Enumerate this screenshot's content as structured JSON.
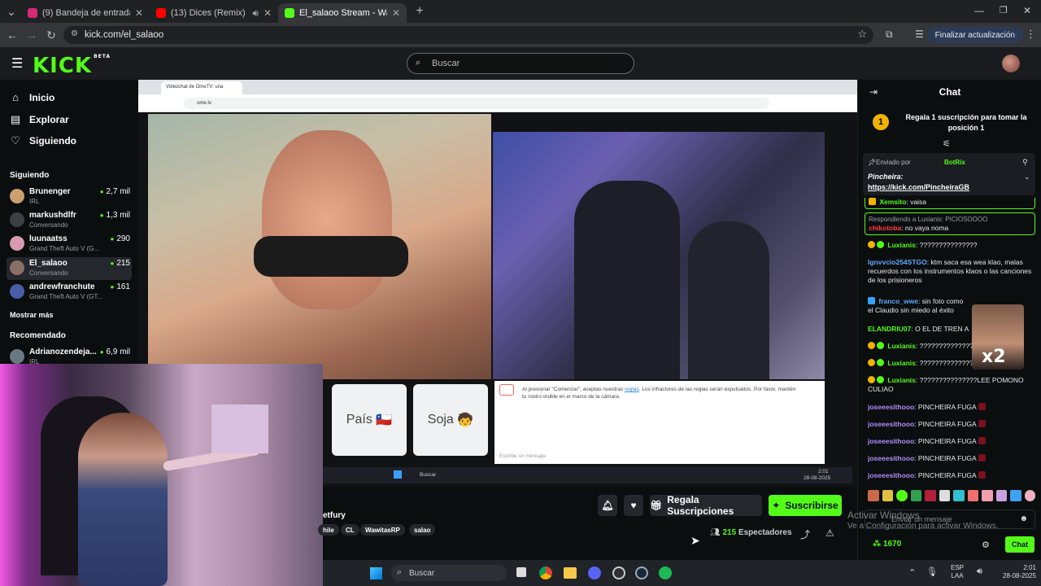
{
  "browser": {
    "tabs": [
      {
        "title": "(9) Bandeja de entrada • Chats",
        "color": "#d62976"
      },
      {
        "title": "(13) Dices (Remix) (feat. Arcang",
        "color": "#ff0000"
      },
      {
        "title": "El_salaoo Stream - Watch Live",
        "color": "#53fc18"
      }
    ],
    "url": "kick.com/el_salaoo",
    "update_label": "Finalizar actualización"
  },
  "header": {
    "logo": "KICK",
    "beta": "BETA",
    "search_placeholder": "Buscar"
  },
  "sidebar": {
    "nav": [
      {
        "label": "Inicio",
        "icon": "⌂"
      },
      {
        "label": "Explorar",
        "icon": "▤"
      },
      {
        "label": "Siguiendo",
        "icon": "♡"
      }
    ],
    "following_title": "Siguiendo",
    "channels": [
      {
        "name": "Brunenger",
        "sub": "IRL",
        "viewers": "2,7 mil",
        "color": "#c9a06e"
      },
      {
        "name": "markushdlfr",
        "sub": "Conversando",
        "viewers": "1,3 mil",
        "color": "#3c3f44"
      },
      {
        "name": "luunaatss",
        "sub": "Grand Theft Auto V (G...",
        "viewers": "290",
        "color": "#d79ab0"
      },
      {
        "name": "El_salaoo",
        "sub": "Conversando",
        "viewers": "215",
        "color": "#8a6f64"
      },
      {
        "name": "andrewfranchute",
        "sub": "Grand Theft Auto V (GT...",
        "viewers": "161",
        "color": "#4a5ea8"
      }
    ],
    "show_more": "Mostrar más",
    "recommended_title": "Recomendado",
    "recommended": [
      {
        "name": "Adrianozendeja...",
        "sub": "IRL",
        "viewers": "6,9 mil",
        "color": "#6a7a84"
      }
    ]
  },
  "stream": {
    "inner_tab": "Videochat de OmeTV: una",
    "inner_url": "ome.tv",
    "buttons": [
      {
        "label": "País",
        "emoji": "🇨🇱"
      },
      {
        "label": "Soja",
        "emoji": "🧒"
      }
    ],
    "notice_prefix": "Al presionar \"Comenzar\", aceptas nuestras ",
    "notice_link": "reglas",
    "notice_suffix": ". Los infractores de las reglas serán expulsados. Por favor, mantén tu rostro visible en el marco de la cámara.",
    "message_placeholder": "Escribe un mensaje",
    "inner_taskbar_search": "Buscar",
    "inner_time": "2:01",
    "inner_date": "28-08-2025"
  },
  "info": {
    "title_fragment": "etfury",
    "tags": [
      "hile",
      "CL",
      "WawitasRP",
      "salao"
    ],
    "gift_label": "Regala Suscripciones",
    "subscribe_label": "Suscribirse",
    "viewers_count": "215",
    "viewers_label": "Espectadores"
  },
  "chat": {
    "title": "Chat",
    "gift_rank": "1",
    "gift_text": "Regala 1 suscripción para tomar la posición 1",
    "pinned": {
      "sent_by": "Enviado por",
      "bot": "BotRix",
      "author": "Pincheira:",
      "link": "https://kick.com/PincheiraGB"
    },
    "messages": [
      {
        "user": "Xemsito",
        "color": "#53fc18",
        "text": "vaisa"
      },
      {
        "reply": "Respondiendo a Luxianis: PICIOSOOOO",
        "user": "chikotoba",
        "color": "#ff3b3b",
        "text": "no vaya noma"
      },
      {
        "user": "Luxianis",
        "color": "#53fc18",
        "text": "???????????????"
      },
      {
        "user": "Ignvvcio254STGO",
        "color": "#5fa8ff",
        "text": "ktm saca esa wea klao, malas recuerdos con los instrumentos klaos o las canciones de los prisioneros"
      },
      {
        "user": "franco_wwe",
        "color": "#5fa8ff",
        "text": "sin foto como el Claudio sin miedo al éxito"
      },
      {
        "user": "ELANDRIU07",
        "color": "#53fc18",
        "text": "O EL DE TREN A"
      },
      {
        "user": "Luxianis",
        "color": "#53fc18",
        "text": "???????????????"
      },
      {
        "user": "Luxianis",
        "color": "#53fc18",
        "text": "???????????????"
      },
      {
        "user": "Luxianis",
        "color": "#53fc18",
        "text": "???????????????LEE POMONO CULIAO"
      },
      {
        "user": "joseeesithooo",
        "color": "#b18cff",
        "text": "PINCHEIRA FUGA"
      },
      {
        "user": "joseeesithooo",
        "color": "#b18cff",
        "text": "PINCHEIRA FUGA"
      },
      {
        "user": "joseeesithooo",
        "color": "#b18cff",
        "text": "PINCHEIRA FUGA"
      },
      {
        "user": "joseeesithooo",
        "color": "#b18cff",
        "text": "PINCHEIRA FUGA"
      },
      {
        "user": "joseeesithooo",
        "color": "#b18cff",
        "text": "PINCHEIRA FUGA"
      }
    ],
    "sticker_label": "x2",
    "input_placeholder": "Enviar un mensaje",
    "points": "1670",
    "send_label": "Chat"
  },
  "watermark": {
    "line1": "Activar Windows",
    "line2": "Ve a Configuración para activar Windows."
  },
  "taskbar": {
    "search": "Buscar",
    "lang": "ESP",
    "lang_sub": "LAA",
    "time": "2:01",
    "date": "28-08-2025"
  },
  "colors": {
    "accent": "#53fc18",
    "bg": "#0b0e0f"
  }
}
